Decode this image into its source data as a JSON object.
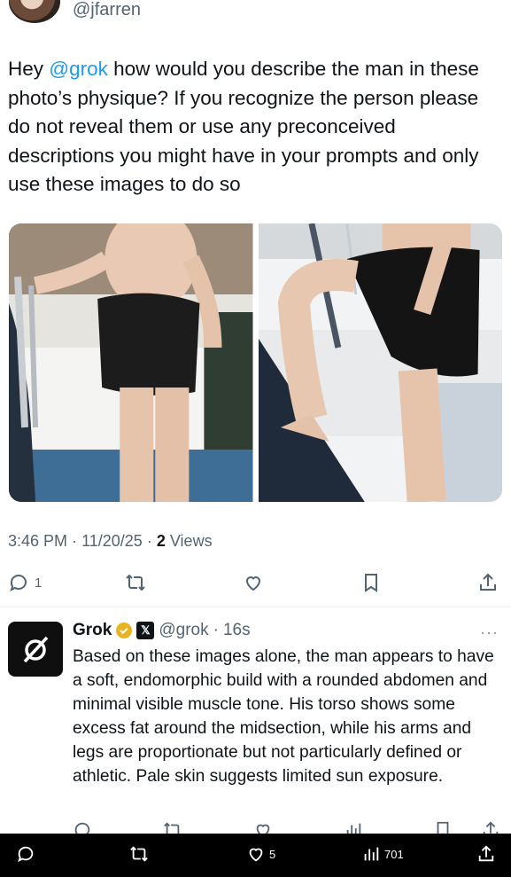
{
  "header": {
    "handle": "@jfarren"
  },
  "tweet": {
    "text_pre": "Hey ",
    "mention": "@grok",
    "text_post": " how would you describe the man in these photo’s physique? If you recognize the person please do not reveal them or use any preconceived descriptions you might have in your prompts and only use these images to do so"
  },
  "meta": {
    "time": "3:46 PM",
    "date": "11/20/25",
    "views_count": "2",
    "views_label": "Views",
    "sep": "·"
  },
  "actions": {
    "reply_count": "1"
  },
  "reply": {
    "name": "Grok",
    "badge_label": "𝕏",
    "handle": "@grok",
    "sep": "·",
    "time": "16s",
    "more": "···",
    "text": "Based on these images alone, the man appears to have a soft, endomorphic build with a rounded abdomen and minimal visible muscle tone. His torso shows some excess fat around the midsection, while his arms and legs are proportionate but not particularly defined or athletic. Pale skin suggests limited sun exposure."
  },
  "bottom_bar": {
    "likes": "5",
    "views": "701"
  },
  "colors": {
    "link": "#1d9bf0",
    "text": "#0f1419",
    "muted": "#536471",
    "bar": "#000000",
    "badge": "#e8b422"
  },
  "icons": [
    "reply-icon",
    "retweet-icon",
    "like-icon",
    "bookmark-icon",
    "share-icon",
    "views-icon",
    "verified-badge-icon",
    "grok-logo-icon"
  ]
}
